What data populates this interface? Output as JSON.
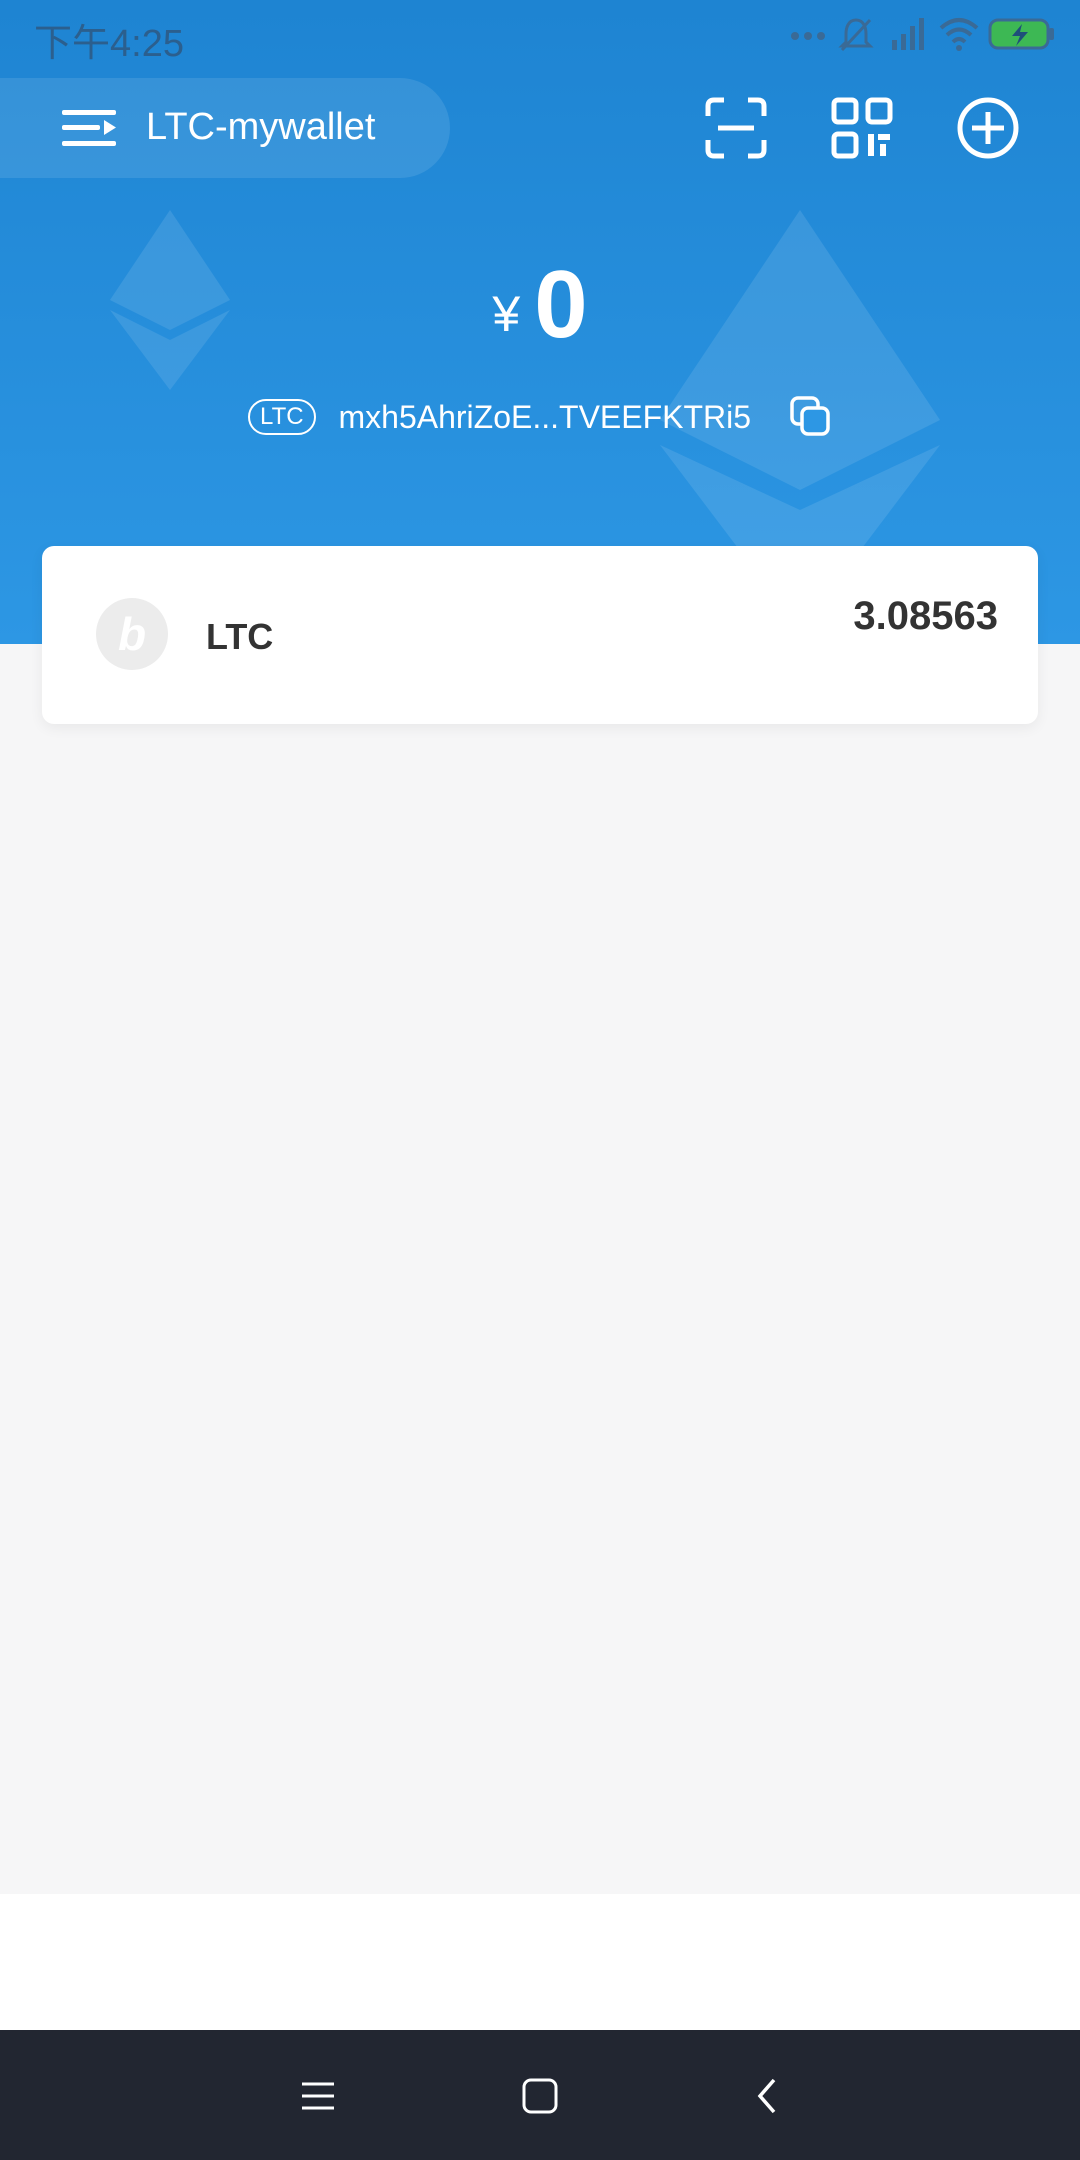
{
  "status_bar": {
    "time": "下午4:25",
    "icons": [
      "more-dots-icon",
      "mute-bell-icon",
      "signal-icon",
      "wifi-icon",
      "battery-charging-icon"
    ]
  },
  "header": {
    "wallet_name": "LTC-mywallet",
    "buttons": [
      "scan-icon",
      "qr-code-icon",
      "add-circle-icon"
    ]
  },
  "balance": {
    "currency_symbol": "¥",
    "value": "0"
  },
  "address": {
    "coin_tag": "LTC",
    "value": "mxh5AhriZoE...TVEEFKTRi5"
  },
  "assets": [
    {
      "logo_letter": "b",
      "name": "LTC",
      "amount": "3.08563"
    }
  ],
  "system_nav": [
    "menu-icon",
    "home-icon",
    "back-icon"
  ],
  "colors": {
    "header_blue": "#1e84d2",
    "page_bg": "#f6f6f7",
    "nav_bar": "#222631",
    "text_dark": "#333333"
  }
}
